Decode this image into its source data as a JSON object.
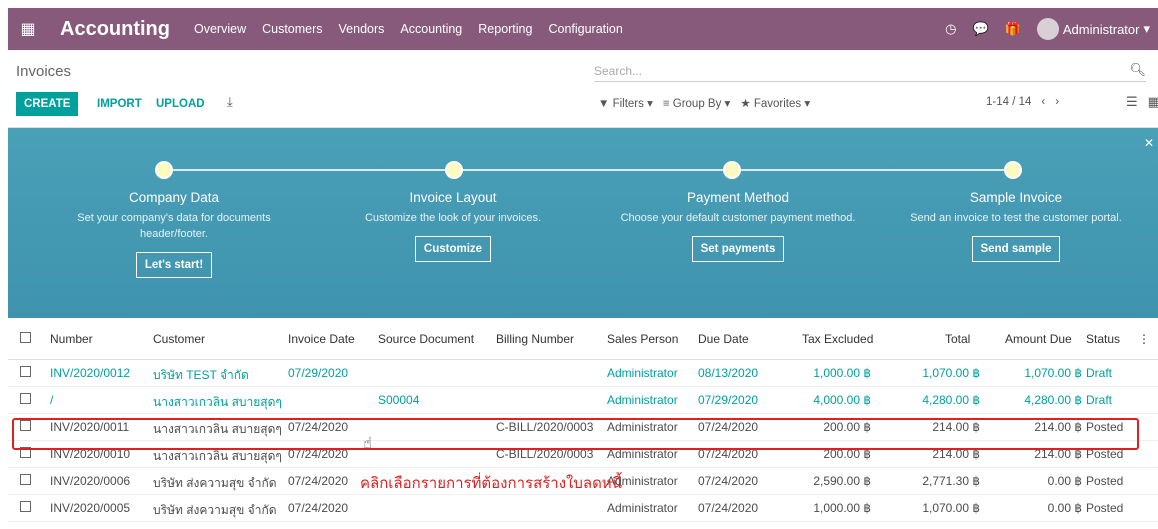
{
  "nav": {
    "brand": "Accounting",
    "menu": [
      "Overview",
      "Customers",
      "Vendors",
      "Accounting",
      "Reporting",
      "Configuration"
    ],
    "user": "Administrator"
  },
  "cp": {
    "breadcrumb": "Invoices",
    "search_placeholder": "Search...",
    "create": "CREATE",
    "import": "IMPORT",
    "upload": "UPLOAD",
    "filters": "Filters",
    "group_by": "Group By",
    "favorites": "Favorites",
    "pager": "1-14 / 14"
  },
  "banner": {
    "steps": [
      {
        "title": "Company Data",
        "desc": "Set your company's data for documents header/footer.",
        "button": "Let's start!"
      },
      {
        "title": "Invoice Layout",
        "desc": "Customize the look of your invoices.",
        "button": "Customize"
      },
      {
        "title": "Payment Method",
        "desc": "Choose your default customer payment method.",
        "button": "Set payments"
      },
      {
        "title": "Sample Invoice",
        "desc": "Send an invoice to test the customer portal.",
        "button": "Send sample"
      }
    ]
  },
  "table": {
    "headers": [
      "Number",
      "Customer",
      "Invoice Date",
      "Source Document",
      "Billing Number",
      "Sales Person",
      "Due Date",
      "Tax Excluded",
      "Total",
      "Amount Due",
      "Status"
    ],
    "rows": [
      [
        "INV/2020/0012",
        "บริษัท TEST จำกัด",
        "07/29/2020",
        "",
        "",
        "Administrator",
        "08/13/2020",
        "1,000.00 ฿",
        "1,070.00 ฿",
        "1,070.00 ฿",
        "Draft"
      ],
      [
        "/",
        "นางสาวเกวลิน สบายสุดๆ",
        "",
        "S00004",
        "",
        "Administrator",
        "07/29/2020",
        "4,000.00 ฿",
        "4,280.00 ฿",
        "4,280.00 ฿",
        "Draft"
      ],
      [
        "INV/2020/0011",
        "นางสาวเกวลิน สบายสุดๆ",
        "07/24/2020",
        "",
        "C-BILL/2020/0003",
        "Administrator",
        "07/24/2020",
        "200.00 ฿",
        "214.00 ฿",
        "214.00 ฿",
        "Posted"
      ],
      [
        "INV/2020/0010",
        "นางสาวเกวลิน สบายสุดๆ",
        "07/24/2020",
        "",
        "C-BILL/2020/0003",
        "Administrator",
        "07/24/2020",
        "200.00 ฿",
        "214.00 ฿",
        "214.00 ฿",
        "Posted"
      ],
      [
        "INV/2020/0006",
        "บริษัท ส่งความสุข จำกัด",
        "07/24/2020",
        "",
        "",
        "Administrator",
        "07/24/2020",
        "2,590.00 ฿",
        "2,771.30 ฿",
        "0.00 ฿",
        "Posted"
      ],
      [
        "INV/2020/0005",
        "บริษัท ส่งความสุข จำกัด",
        "07/24/2020",
        "",
        "",
        "Administrator",
        "07/24/2020",
        "1,000.00 ฿",
        "1,070.00 ฿",
        "0.00 ฿",
        "Posted"
      ]
    ]
  },
  "annotation": "คลิกเลือกรายการที่ต้องการสร้างใบลดหนี้",
  "colors": {
    "brand": "#875a7b",
    "accent": "#00a09d",
    "highlight": "#e02020"
  }
}
